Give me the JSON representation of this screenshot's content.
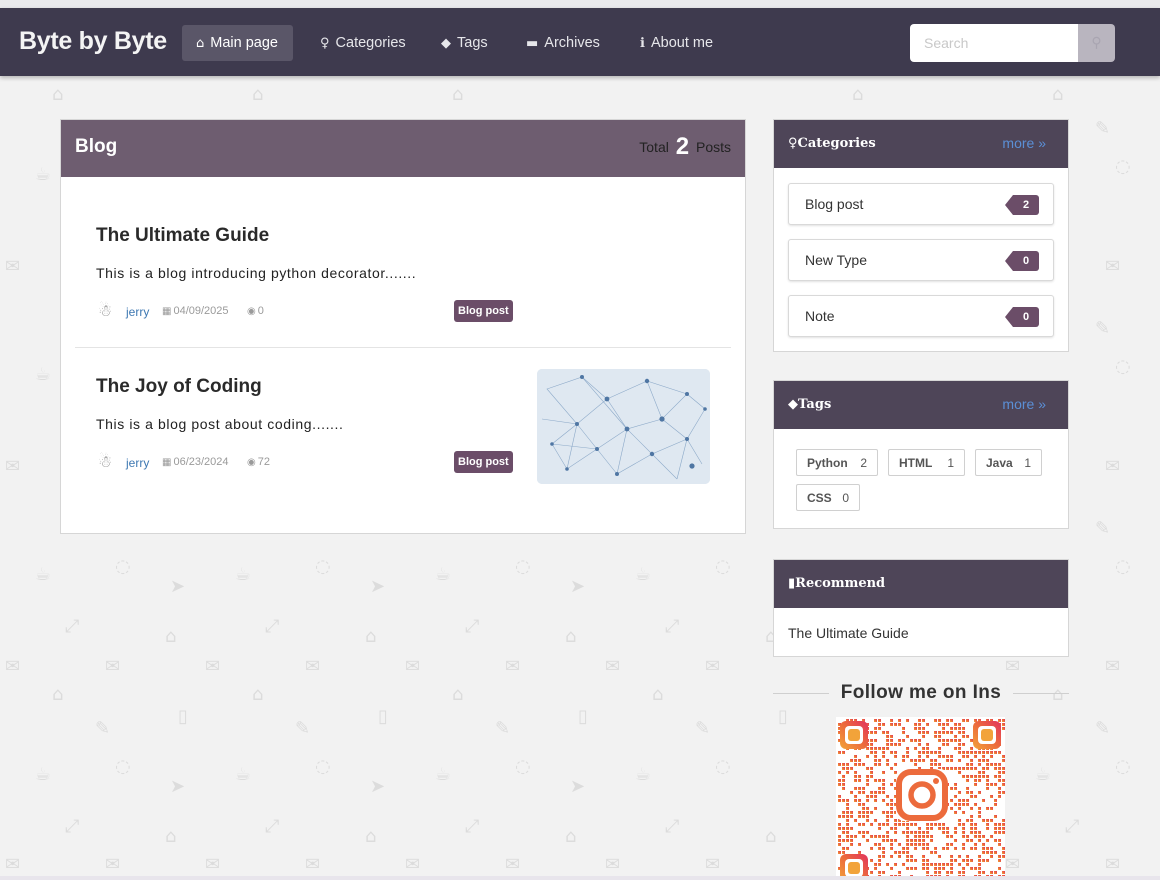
{
  "app": {
    "brand": "Byte by Byte"
  },
  "nav": {
    "items": [
      {
        "label": "Main page",
        "icon": "home-icon",
        "active": true
      },
      {
        "label": "Categories",
        "icon": "lightbulb-icon",
        "active": false
      },
      {
        "label": "Tags",
        "icon": "tags-icon",
        "active": false
      },
      {
        "label": "Archives",
        "icon": "folder-icon",
        "active": false
      },
      {
        "label": "About me",
        "icon": "info-icon",
        "active": false
      }
    ],
    "search_placeholder": "Search"
  },
  "blog": {
    "title": "Blog",
    "total_prefix": "Total",
    "total_count": "2",
    "total_suffix": "Posts",
    "posts": [
      {
        "title": "The Ultimate Guide",
        "excerpt": "This is a blog introducing python decorator.......",
        "author": "jerry",
        "date": "04/09/2025",
        "views": "0",
        "category": "Blog post"
      },
      {
        "title": "The Joy of Coding",
        "excerpt": "This is a blog post about coding.......",
        "author": "jerry",
        "date": "06/23/2024",
        "views": "72",
        "category": "Blog post",
        "has_thumbnail": true
      }
    ]
  },
  "sidebar": {
    "categories": {
      "title": "Categories",
      "more": "more",
      "items": [
        {
          "label": "Blog post",
          "count": "2"
        },
        {
          "label": "New Type",
          "count": "0"
        },
        {
          "label": "Note",
          "count": "0"
        }
      ]
    },
    "tags": {
      "title": "Tags",
      "more": "more",
      "items": [
        {
          "label": "Python",
          "count": "2"
        },
        {
          "label": "HTML",
          "count": "1"
        },
        {
          "label": "Java",
          "count": "1"
        },
        {
          "label": "CSS",
          "count": "0"
        }
      ]
    },
    "recommend": {
      "title": "Recommend",
      "items": [
        "The Ultimate Guide"
      ]
    },
    "follow": {
      "text": "Follow me on Ins"
    }
  },
  "colors": {
    "navbar": "#3e3a4e",
    "blog_header": "#6e5d70",
    "sidebar_header": "#4e4558",
    "badge": "#6b4d68",
    "link": "#3e78b2",
    "more_link": "#5b8fd6"
  }
}
